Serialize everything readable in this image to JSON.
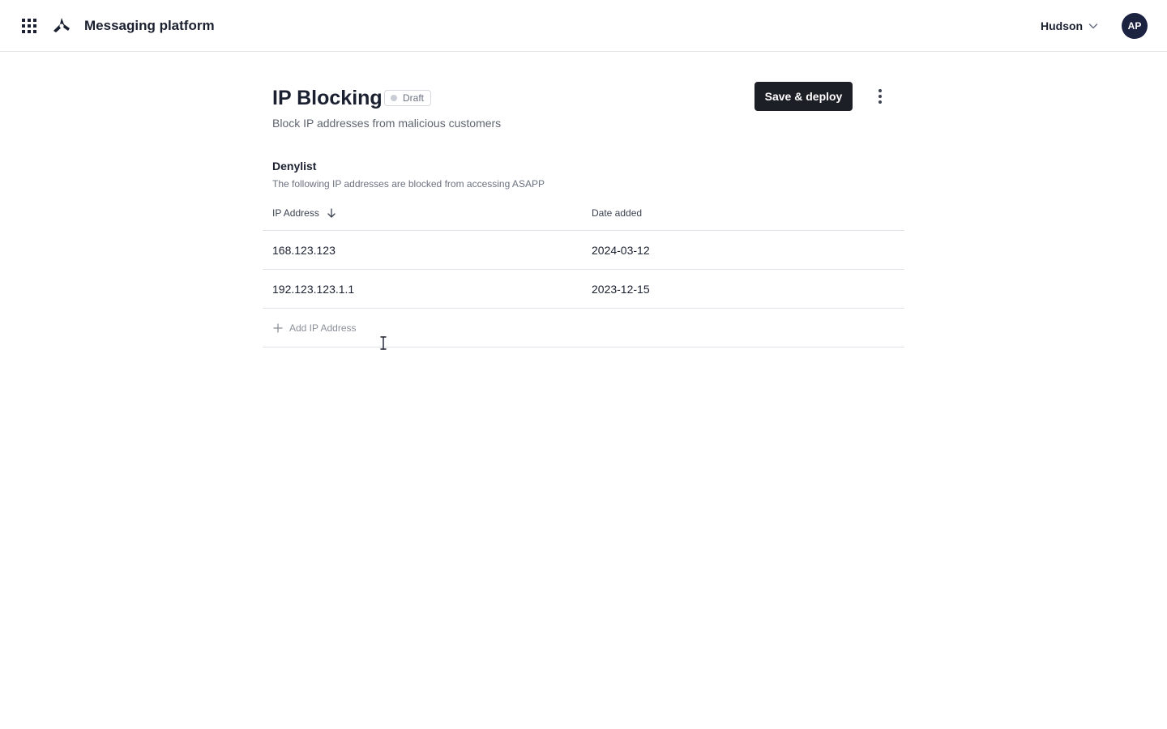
{
  "header": {
    "app_title": "Messaging platform",
    "org_name": "Hudson",
    "avatar_initials": "AP"
  },
  "page": {
    "title": "IP Blocking",
    "status": "Draft",
    "subtitle": "Block IP addresses from malicious customers",
    "save_label": "Save & deploy"
  },
  "denylist": {
    "title": "Denylist",
    "description": "The following IP addresses are blocked from accessing ASAPP",
    "columns": [
      "IP Address",
      "Date added"
    ],
    "sort": "descending",
    "rows": [
      {
        "ip": "168.123.123",
        "date": "2024-03-12"
      },
      {
        "ip": "192.123.123.1.1",
        "date": "2023-12-15"
      }
    ],
    "add_label": "Add IP Address"
  },
  "icons": {
    "apps": "apps-grid-icon",
    "logo": "brand-logo-icon",
    "org_chevron": "chevron-down-icon",
    "more": "more-vertical-icon",
    "sort": "arrow-down-icon",
    "add": "plus-icon",
    "cursor": "text-cursor-icon"
  },
  "colors": {
    "primary_button": "#1d1f26",
    "avatar_bg": "#1b2340",
    "text_primary": "#1b2030",
    "text_muted": "#6b7280",
    "divider": "#dfe2e6",
    "draft_dot": "#c9ced6"
  }
}
